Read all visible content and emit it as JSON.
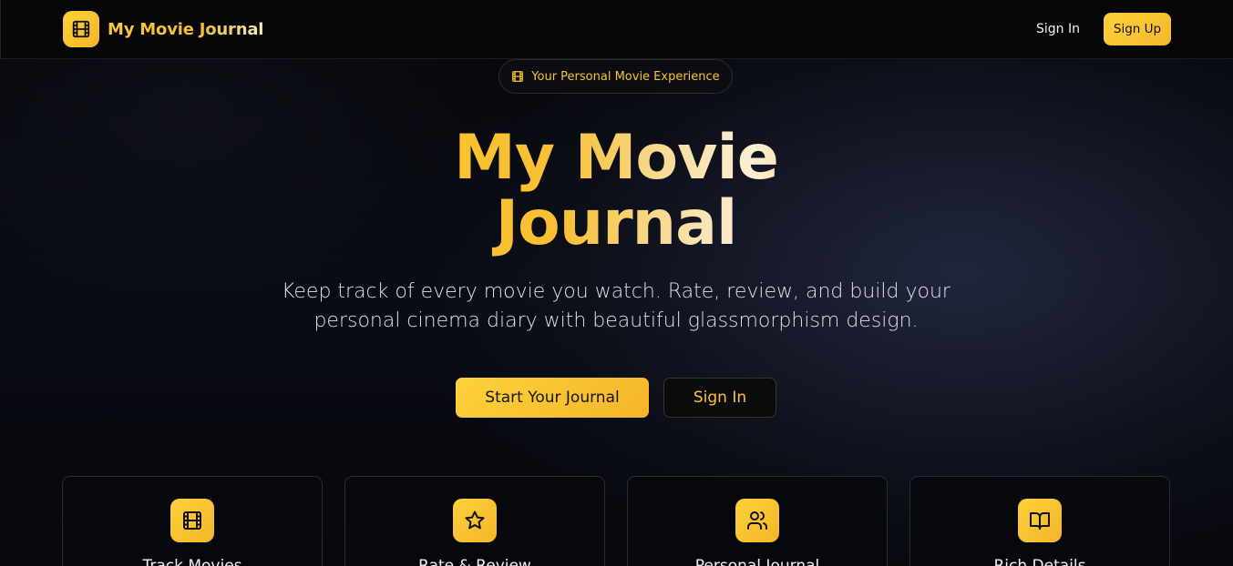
{
  "navbar": {
    "brand": "My Movie Journal",
    "logo_icon": "film-icon",
    "sign_in": "Sign In",
    "sign_up": "Sign Up"
  },
  "hero": {
    "badge_icon": "film-icon",
    "badge": "Your Personal Movie Experience",
    "title_line1": "My Movie",
    "title_line2": "Journal",
    "subtitle_line1": "Keep track of every movie you watch. Rate, review, and build your",
    "subtitle_line2": "personal cinema diary with beautiful glassmorphism design.",
    "primary_cta": "Start Your Journal",
    "secondary_cta": "Sign In"
  },
  "features": [
    {
      "icon": "film-icon",
      "title": "Track Movies"
    },
    {
      "icon": "star-icon",
      "title": "Rate & Review"
    },
    {
      "icon": "users-icon",
      "title": "Personal Journal"
    },
    {
      "icon": "book-open-icon",
      "title": "Rich Details"
    }
  ],
  "colors": {
    "accent": "#f7c235",
    "accent_light": "#fcd23a",
    "background": "#07080d"
  }
}
